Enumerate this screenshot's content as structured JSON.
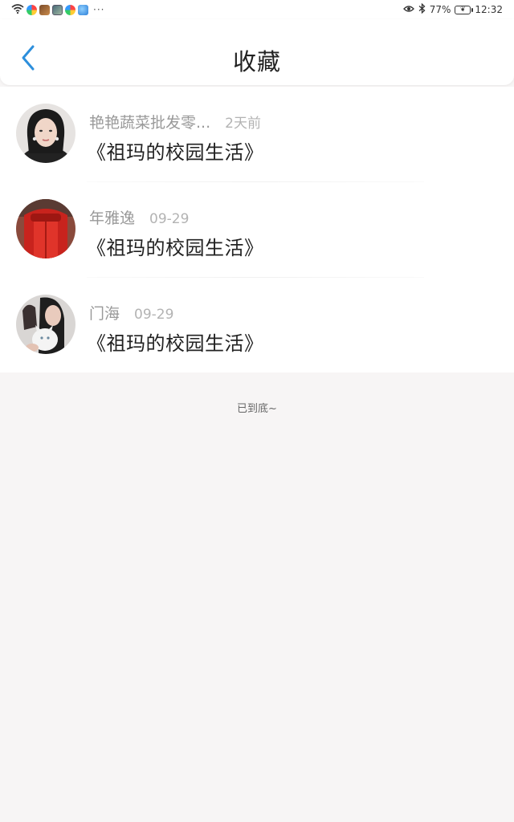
{
  "status_bar": {
    "battery_percent": "77%",
    "time": "12:32",
    "overflow_dots": "···",
    "icons": [
      "wifi-icon",
      "colorful-app-icon",
      "photo-app-icon",
      "gallery-app-icon",
      "colorful-app-icon",
      "blue-app-icon",
      "eye-icon",
      "bluetooth-icon",
      "battery-icon"
    ]
  },
  "header": {
    "title": "收藏",
    "back_icon": "chevron-left-icon",
    "accent_color": "#2d8fdc"
  },
  "favorites": [
    {
      "author": "艳艳蔬菜批发零...",
      "time": "2天前",
      "book": "《祖玛的校园生活》"
    },
    {
      "author": "年雅逸",
      "time": "09-29",
      "book": "《祖玛的校园生活》"
    },
    {
      "author": "门海",
      "time": "09-29",
      "book": "《祖玛的校园生活》"
    }
  ],
  "footer": {
    "end_text": "已到底~"
  }
}
